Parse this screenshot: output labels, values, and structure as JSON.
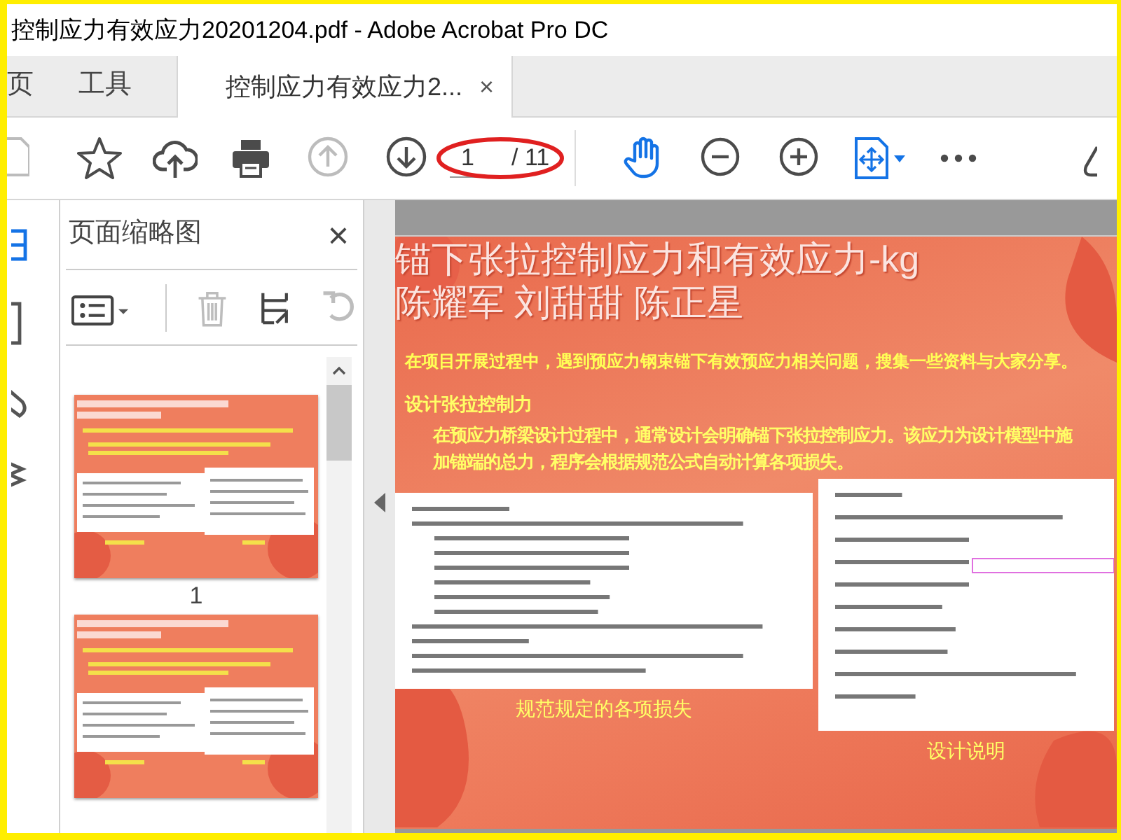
{
  "window": {
    "title": "控制应力有效应力20201204.pdf - Adobe Acrobat Pro DC"
  },
  "tabs": [
    {
      "label": "页",
      "selected": false
    },
    {
      "label": "工具",
      "selected": false
    },
    {
      "label": "控制应力有效应力2...",
      "selected": true,
      "close": "×"
    }
  ],
  "toolbar": {
    "buttons": [
      {
        "kind": "page",
        "disabled": true
      },
      {
        "kind": "star",
        "disabled": false
      },
      {
        "kind": "upload",
        "disabled": false
      },
      {
        "kind": "print",
        "disabled": false
      },
      {
        "kind": "prev",
        "disabled": true
      },
      {
        "kind": "next",
        "disabled": false
      },
      {
        "kind": "hand",
        "disabled": false
      },
      {
        "kind": "zoom-out",
        "disabled": false
      },
      {
        "kind": "zoom-in",
        "disabled": false
      },
      {
        "kind": "fit",
        "disabled": false
      },
      {
        "kind": "more",
        "disabled": false
      },
      {
        "kind": "pen",
        "disabled": false
      }
    ],
    "page_number": "1",
    "page_total": "/ 11"
  },
  "rail": [
    {
      "kind": "thumbnails",
      "selected": true
    },
    {
      "kind": "bookmark",
      "selected": false
    },
    {
      "kind": "attachment",
      "selected": false
    },
    {
      "kind": "layers",
      "selected": false
    }
  ],
  "panel": {
    "title": "页面缩略图",
    "close": "×",
    "tools": [
      {
        "kind": "options",
        "disabled": false
      },
      {
        "kind": "delete",
        "disabled": true
      },
      {
        "kind": "crop",
        "disabled": false
      },
      {
        "kind": "rotate",
        "disabled": true
      }
    ],
    "thumbnails": [
      {
        "kind": "slide",
        "label": "1"
      },
      {
        "kind": "slide"
      }
    ]
  },
  "page": {
    "title_lines": [
      "锚下张拉控制应力和有效应力-kg",
      "陈耀军 刘甜甜 陈正星"
    ],
    "intro": "在项目开展过程中，遇到预应力钢束锚下有效预应力相关问题，搜集一些资料与大家分享。",
    "heading": "设计张拉控制力",
    "paragraph": "在预应力桥梁设计过程中，通常设计会明确锚下张拉控制应力。该应力为设计模型中施加锚端的总力，程序会根据规范公式自动计算各项损失。",
    "figures": [
      {
        "kind": "picture",
        "caption": "规范规定的各项损失"
      },
      {
        "kind": "picture",
        "caption": "设计说明"
      }
    ]
  }
}
